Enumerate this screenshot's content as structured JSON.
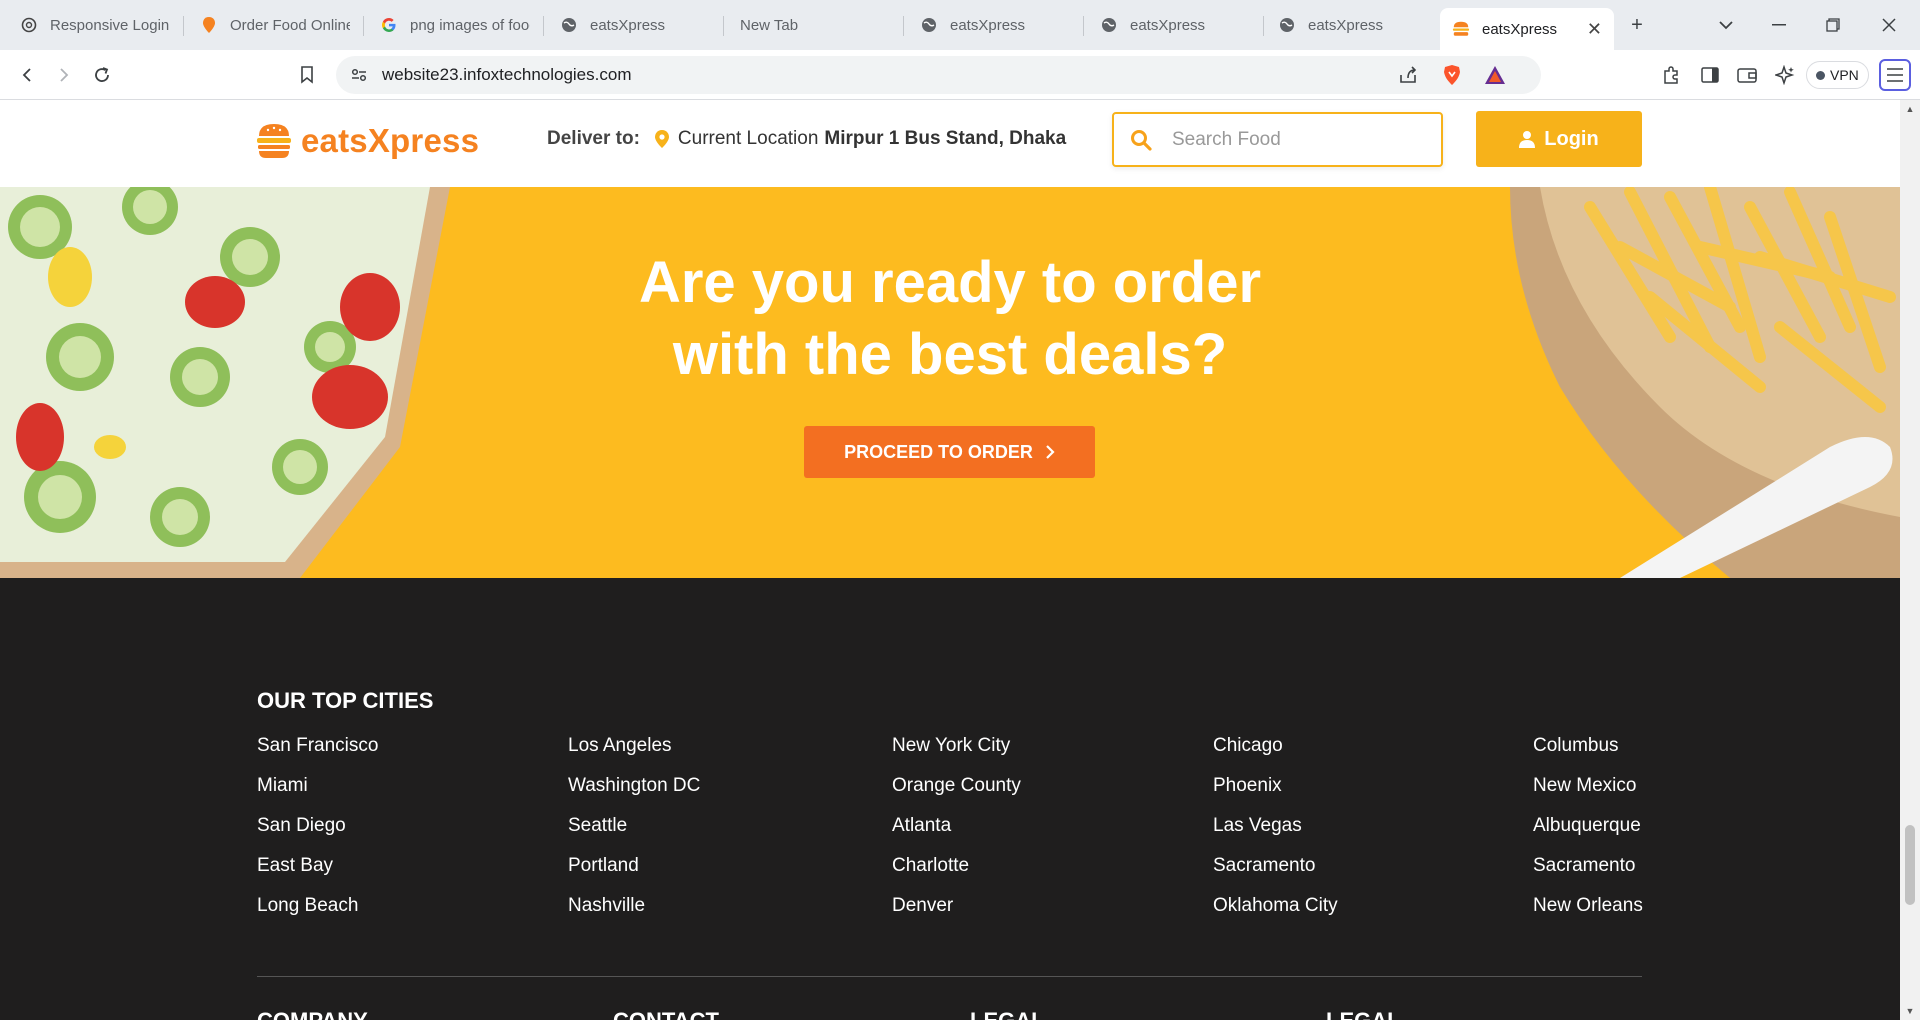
{
  "browser": {
    "tabs": [
      {
        "title": "Responsive Login",
        "icon": "openai-icon"
      },
      {
        "title": "Order Food Online",
        "icon": "swiggy-icon"
      },
      {
        "title": "png images of food",
        "icon": "google-icon"
      },
      {
        "title": "eatsXpress",
        "icon": "globe-icon"
      },
      {
        "title": "New Tab",
        "icon": ""
      },
      {
        "title": "eatsXpress",
        "icon": "globe-icon"
      },
      {
        "title": "eatsXpress",
        "icon": "globe-icon"
      },
      {
        "title": "eatsXpress",
        "icon": "globe-icon"
      },
      {
        "title": "eatsXpress",
        "icon": "burger-icon",
        "active": true
      }
    ],
    "url": "website23.infoxtechnologies.com",
    "vpn_label": "VPN"
  },
  "header": {
    "brand": "eatsXpress",
    "deliver_label": "Deliver to:",
    "location_prefix": "Current Location",
    "location": "Mirpur 1 Bus Stand, Dhaka",
    "search_placeholder": "Search Food",
    "login_label": "Login"
  },
  "hero": {
    "title_line1": "Are you ready to order",
    "title_line2": "with the best deals?",
    "cta_label": "PROCEED TO ORDER"
  },
  "footer": {
    "cities_heading": "OUR TOP CITIES",
    "city_columns": [
      [
        "San Francisco",
        "Miami",
        "San Diego",
        "East Bay",
        "Long Beach"
      ],
      [
        "Los Angeles",
        "Washington DC",
        "Seattle",
        "Portland",
        "Nashville"
      ],
      [
        "New York City",
        "Orange County",
        "Atlanta",
        "Charlotte",
        "Denver"
      ],
      [
        "Chicago",
        "Phoenix",
        "Las Vegas",
        "Sacramento",
        "Oklahoma City"
      ],
      [
        "Columbus",
        "New Mexico",
        "Albuquerque",
        "Sacramento",
        "New Orleans"
      ]
    ],
    "section_headings": [
      "COMPANY",
      "CONTACT",
      "LEGAL",
      "LEGAL"
    ]
  },
  "colors": {
    "brand_orange": "#f58220",
    "accent_yellow": "#f7b21a",
    "hero_bg": "#fdbb1f",
    "cta_orange": "#f36f21",
    "footer_bg": "#1f1e1e"
  }
}
